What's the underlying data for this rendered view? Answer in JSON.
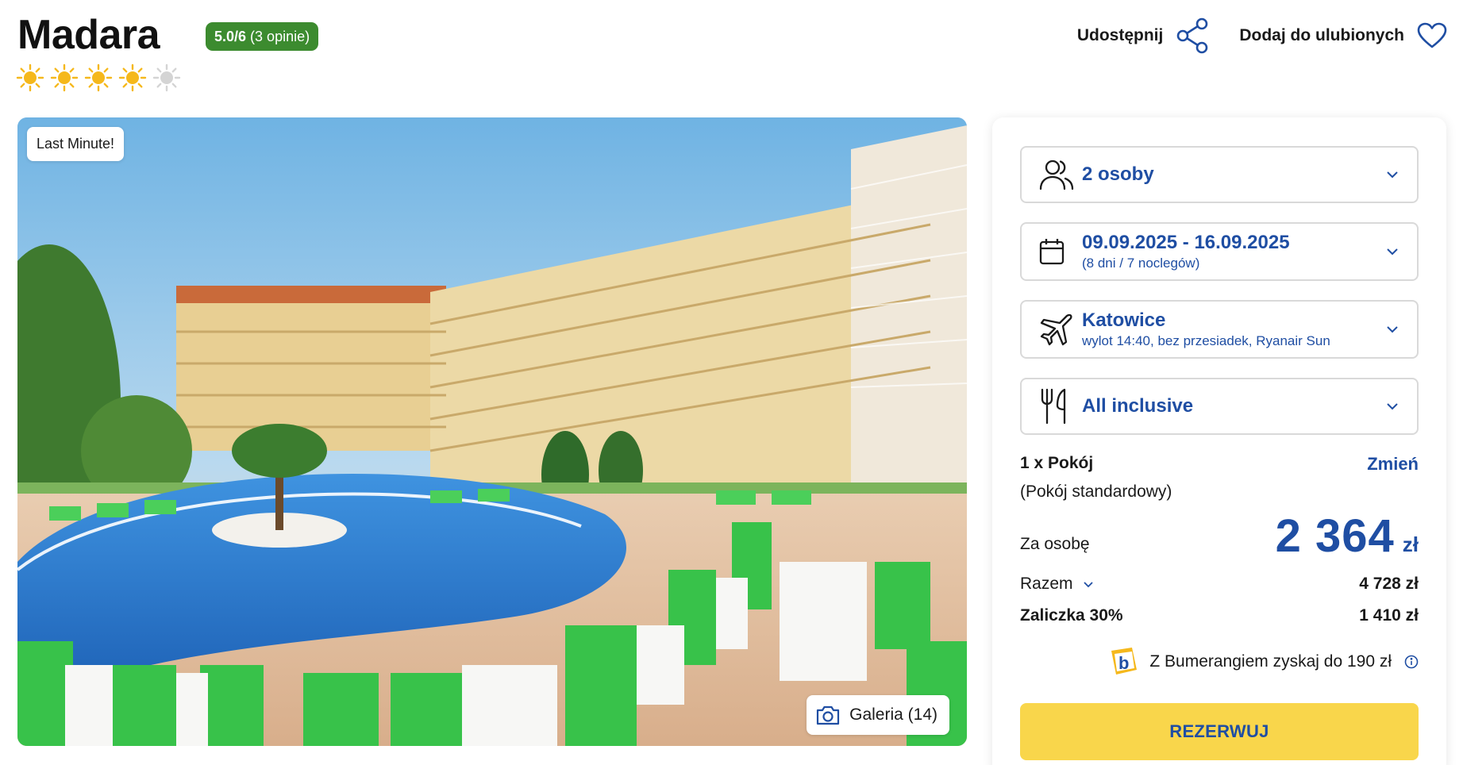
{
  "hotel": {
    "name": "Madara",
    "rating_score": "5.0/6",
    "rating_count": "(3 opinie)",
    "stars_filled": 4,
    "stars_total": 5
  },
  "header_actions": {
    "share_label": "Udostępnij",
    "favorite_label": "Dodaj do ulubionych"
  },
  "gallery": {
    "badge": "Last Minute!",
    "gallery_label": "Galeria (14)"
  },
  "booking": {
    "persons": {
      "value": "2 osoby",
      "icon": "persons-icon"
    },
    "dates": {
      "value": "09.09.2025 - 16.09.2025",
      "detail": "(8 dni / 7 noclegów)",
      "icon": "calendar-icon"
    },
    "flight": {
      "value": "Katowice",
      "detail": "wylot 14:40, bez przesiadek, Ryanair Sun",
      "icon": "plane-icon"
    },
    "board": {
      "value": "All inclusive",
      "icon": "cutlery-icon"
    },
    "room": {
      "line": "1 x Pokój",
      "type": "(Pokój standardowy)",
      "change": "Zmień"
    },
    "price": {
      "per_person_label": "Za osobę",
      "per_person_amount": "2 364",
      "currency": "zł",
      "total_label": "Razem",
      "total_value": "4 728 zł",
      "deposit_label": "Zaliczka 30%",
      "deposit_value": "1 410 zł"
    },
    "bonus_text": "Z Bumerangiem zyskaj do 190 zł",
    "cta_label": "REZERWUJ"
  },
  "colors": {
    "brand_blue": "#1f4ea3",
    "rating_green": "#3c8b2f",
    "cta_yellow": "#f9d64b",
    "star_active": "#f5b81c",
    "star_inactive": "#d4d4d4"
  }
}
